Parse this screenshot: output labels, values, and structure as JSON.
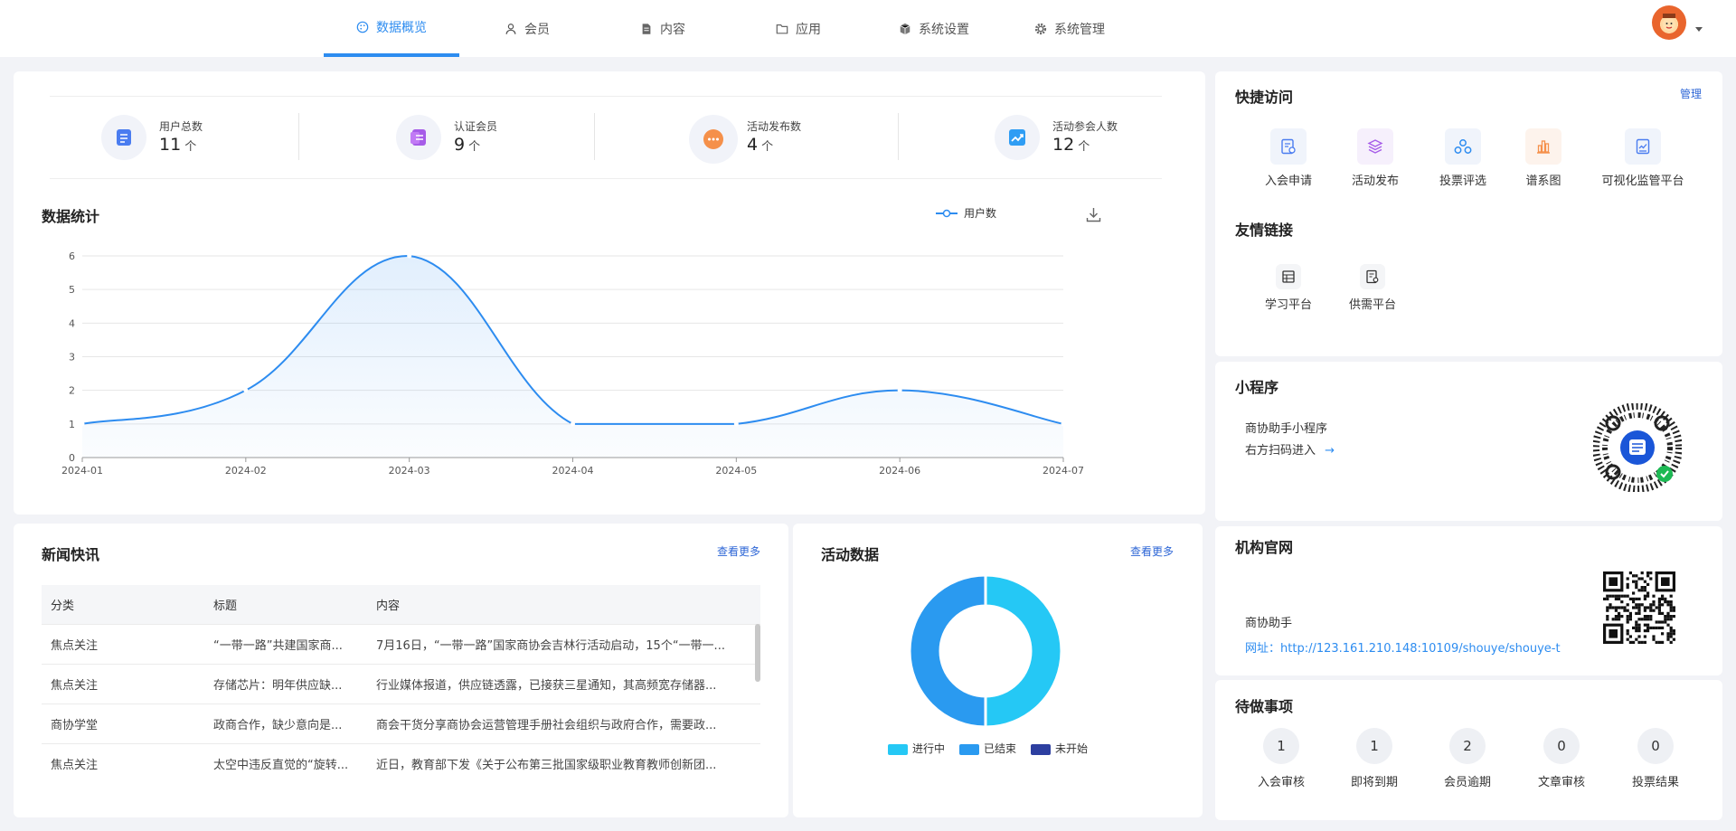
{
  "nav": {
    "tabs": [
      {
        "label": "数据概览",
        "icon": "palette-icon"
      },
      {
        "label": "会员",
        "icon": "user-icon"
      },
      {
        "label": "内容",
        "icon": "document-icon"
      },
      {
        "label": "应用",
        "icon": "folder-icon"
      },
      {
        "label": "系统设置",
        "icon": "cube-icon"
      },
      {
        "label": "系统管理",
        "icon": "gear-icon"
      }
    ],
    "active_tab": 0
  },
  "stats": [
    {
      "label": "用户总数",
      "value": "11",
      "unit": "个",
      "color": "#4a7cf0"
    },
    {
      "label": "认证会员",
      "value": "9",
      "unit": "个",
      "color": "#a65ce8"
    },
    {
      "label": "活动发布数",
      "value": "4",
      "unit": "个",
      "color": "#f5904a"
    },
    {
      "label": "活动参会人数",
      "value": "12",
      "unit": "个",
      "color": "#2f9df4"
    }
  ],
  "data_stats": {
    "title": "数据统计",
    "legend": "用户数"
  },
  "chart_data": {
    "type": "area",
    "x": [
      "2024-01",
      "2024-02",
      "2024-03",
      "2024-04",
      "2024-05",
      "2024-06",
      "2024-07"
    ],
    "series": [
      {
        "name": "用户数",
        "values": [
          1,
          2,
          6,
          1,
          1,
          2,
          1
        ]
      }
    ],
    "ylim": [
      0,
      6
    ],
    "yticks": [
      "0",
      "1",
      "2",
      "3",
      "4",
      "5",
      "6"
    ],
    "grid": true,
    "legend_position": "top-right",
    "color": "#2d8cf0"
  },
  "news": {
    "title": "新闻快讯",
    "more": "查看更多",
    "columns": [
      "分类",
      "标题",
      "内容"
    ],
    "rows": [
      [
        "焦点关注",
        "“一带一路”共建国家商...",
        "7月16日，“一带一路”国家商协会吉林行活动启动，15个“一带一..."
      ],
      [
        "焦点关注",
        "存储芯片：明年供应缺...",
        "行业媒体报道，供应链透露，已接获三星通知，其高频宽存储器..."
      ],
      [
        "商协学堂",
        "政商合作，缺少意向是...",
        "商会干货分享商协会运营管理手册社会组织与政府合作，需要政..."
      ],
      [
        "焦点关注",
        "太空中违反直觉的“旋转...",
        "近日，教育部下发《关于公布第三批国家级职业教育教师创新团..."
      ]
    ]
  },
  "activity": {
    "title": "活动数据",
    "more": "查看更多",
    "legend": [
      {
        "label": "进行中",
        "color": "#25c8f5"
      },
      {
        "label": "已结束",
        "color": "#2a9af0"
      },
      {
        "label": "未开始",
        "color": "#2d3fa0"
      }
    ],
    "values": [
      50,
      50,
      0
    ]
  },
  "quick_access": {
    "title": "快捷访问",
    "manage": "管理",
    "items": [
      {
        "label": "入会申请",
        "icon": "application-icon",
        "color": "#4a7cf0"
      },
      {
        "label": "活动发布",
        "icon": "layers-icon",
        "color": "#a65ce8"
      },
      {
        "label": "投票评选",
        "icon": "vote-icon",
        "color": "#2d8cf0"
      },
      {
        "label": "谱系图",
        "icon": "bar-chart-icon",
        "color": "#f5904a"
      },
      {
        "label": "可视化监管平台",
        "icon": "monitor-chart-icon",
        "color": "#4a7cf0"
      }
    ]
  },
  "links": {
    "title": "友情链接",
    "items": [
      {
        "label": "学习平台",
        "icon": "table-icon"
      },
      {
        "label": "供需平台",
        "icon": "document-search-icon"
      }
    ]
  },
  "mini_program": {
    "title": "小程序",
    "line1": "商协助手小程序",
    "line2": "右方扫码进入",
    "arrow": "→"
  },
  "website": {
    "title": "机构官网",
    "name": "商协助手",
    "url_label": "网址：",
    "url": "http://123.161.210.148:10109/shouye/shouye-t"
  },
  "todo": {
    "title": "待做事项",
    "items": [
      {
        "count": "1",
        "label": "入会审核"
      },
      {
        "count": "1",
        "label": "即将到期"
      },
      {
        "count": "2",
        "label": "会员逾期"
      },
      {
        "count": "0",
        "label": "文章审核"
      },
      {
        "count": "0",
        "label": "投票结果"
      }
    ]
  }
}
